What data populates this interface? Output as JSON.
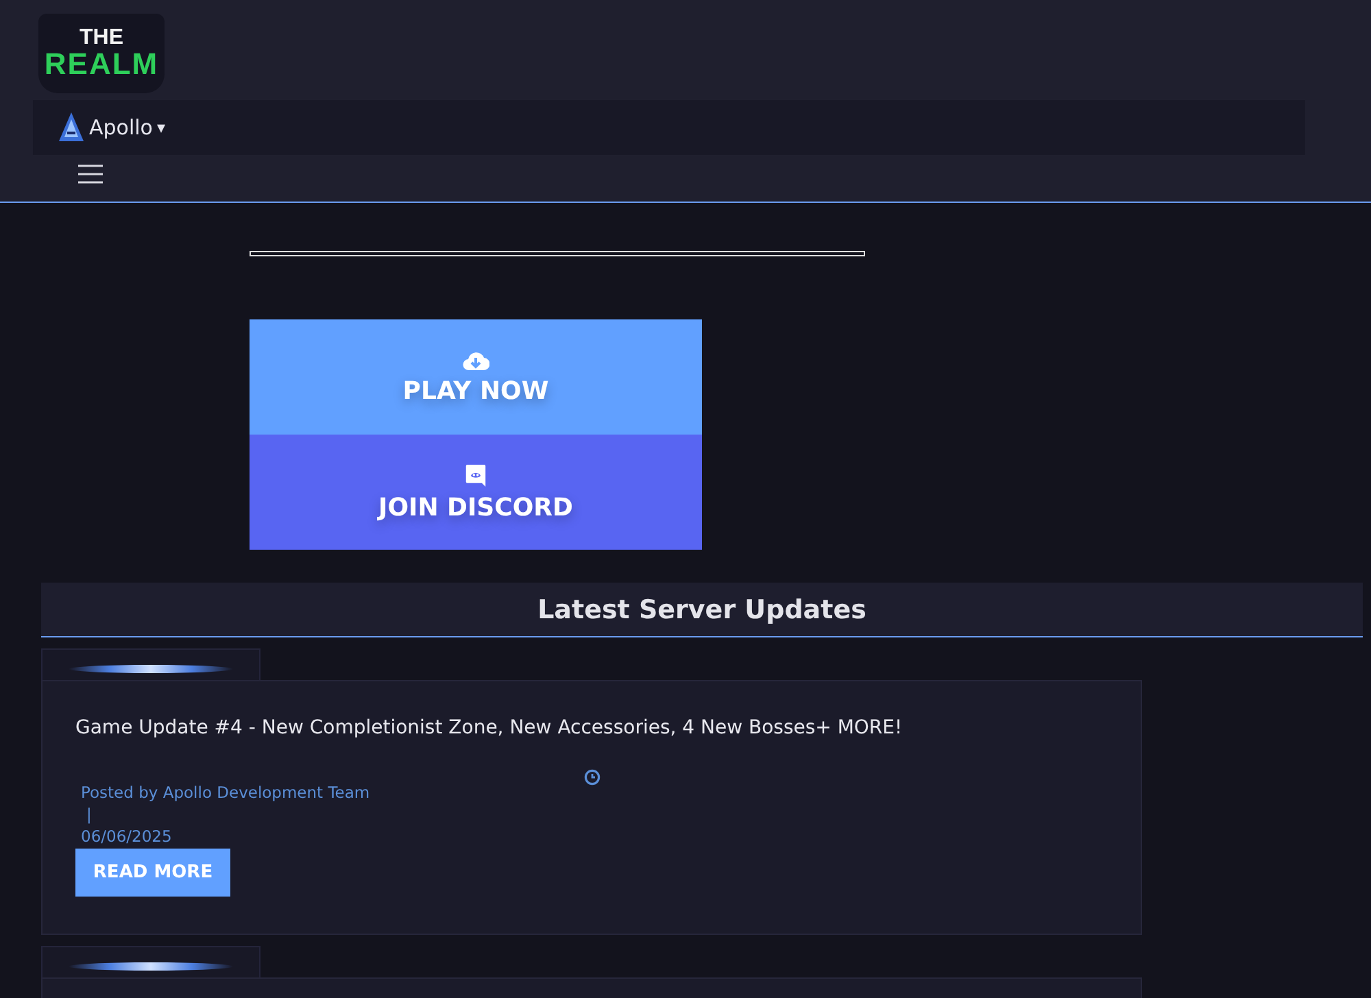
{
  "logo": {
    "line_1": "THE",
    "line_2": "REALM"
  },
  "nav": {
    "server": "Apollo",
    "caret": "▾"
  },
  "buttons": [
    {
      "kind": "download",
      "label": "PLAY NOW"
    },
    {
      "kind": "discord",
      "label": "JOIN DISCORD"
    }
  ],
  "section_title": "Latest Server Updates",
  "posts": [
    {
      "title": "Game Update #4 - New Completionist Zone, New Accessories, 4 New Bosses+ MORE!",
      "author": "Posted by Apollo Development Team",
      "separator": "|",
      "date": "06/06/2025",
      "button": "READ MORE"
    }
  ]
}
